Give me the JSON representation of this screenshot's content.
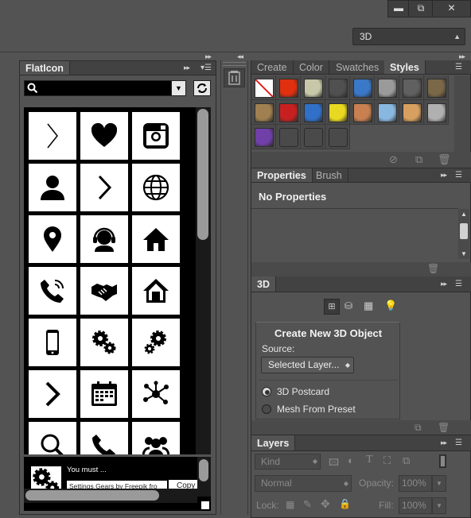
{
  "window": {
    "minimize": "▬",
    "restore": "⧉",
    "close": "✕"
  },
  "workspace": {
    "selected": "3D"
  },
  "flaticon": {
    "tab_label": "FlatIcon",
    "search_value": "",
    "icons": [
      "chevron-right-thin",
      "heart",
      "instagram",
      "user",
      "chevron-right",
      "globe",
      "location-pin",
      "headset-support",
      "house",
      "phone-call",
      "handshake",
      "home",
      "smartphone",
      "gears",
      "gear-small",
      "chevron-right-bold",
      "calendar",
      "network",
      "magnifier",
      "phone",
      "group"
    ],
    "footer_title": "You must ...",
    "footer_attrib": "Settings Gears by Freepik fro",
    "footer_copy": "Copy"
  },
  "styles_panel": {
    "tabs": [
      "Create",
      "Color",
      "Swatches",
      "Styles"
    ],
    "active_tab": "Styles",
    "swatch_colors": [
      "none",
      "#e03010",
      "#c8c8a8",
      "#505050",
      "#3a78c8",
      "#9a9a9a",
      "#606060",
      "#7a6848",
      "#a08050",
      "#c82020",
      "#3070c8",
      "#e8d820",
      "#c88050",
      "#88b8e0",
      "#d8a060",
      "#b0b0b0",
      "#7040a8",
      "#404040",
      "#404040",
      "#404040"
    ]
  },
  "properties_panel": {
    "tabs": [
      "Properties",
      "Brush"
    ],
    "active_tab": "Properties",
    "content": "No Properties"
  },
  "threed_panel": {
    "tab": "3D",
    "heading": "Create New 3D Object",
    "source_label": "Source:",
    "source_value": "Selected Layer...",
    "options": [
      "3D Postcard",
      "Mesh From Preset"
    ],
    "selected_option": "3D Postcard"
  },
  "layers_panel": {
    "tab": "Layers",
    "kind_label": "Kind",
    "blend_mode": "Normal",
    "opacity_label": "Opacity:",
    "opacity_value": "100%",
    "lock_label": "Lock:",
    "fill_label": "Fill:",
    "fill_value": "100%"
  }
}
